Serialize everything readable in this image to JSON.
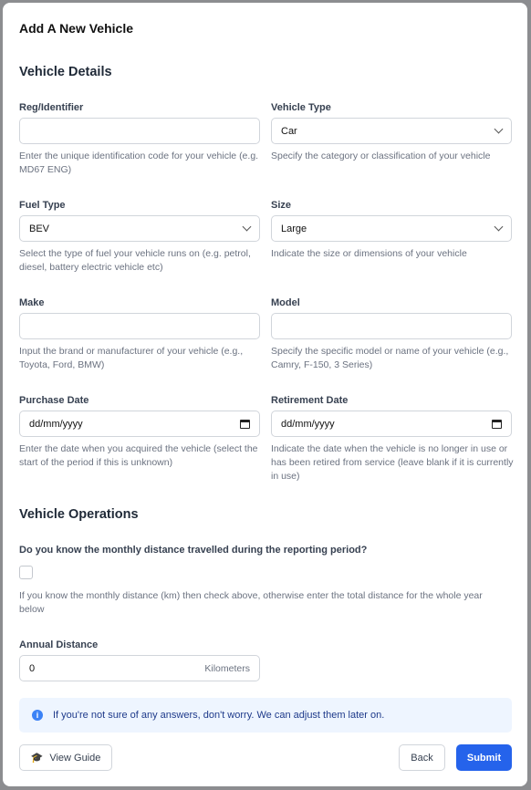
{
  "title": "Add A New Vehicle",
  "details": {
    "heading": "Vehicle Details",
    "fields": [
      {
        "label": "Reg/Identifier",
        "value": "",
        "help": "Enter the unique identification code for your vehicle (e.g. MD67 ENG)"
      },
      {
        "label": "Vehicle Type",
        "value": "Car",
        "help": "Specify the category or classification of your vehicle"
      },
      {
        "label": "Fuel Type",
        "value": "BEV",
        "help": "Select the type of fuel your vehicle runs on (e.g. petrol, diesel, battery electric vehicle etc)"
      },
      {
        "label": "Size",
        "value": "Large",
        "help": "Indicate the size or dimensions of your vehicle"
      },
      {
        "label": "Make",
        "value": "",
        "help": "Input the brand or manufacturer of your vehicle (e.g., Toyota, Ford, BMW)"
      },
      {
        "label": "Model",
        "value": "",
        "help": "Specify the specific model or name of your vehicle (e.g., Camry, F-150, 3 Series)"
      },
      {
        "label": "Purchase Date",
        "value": "dd/mm/yyyy",
        "help": "Enter the date when you acquired the vehicle (select the start of the period if this is unknown)"
      },
      {
        "label": "Retirement Date",
        "value": "dd/mm/yyyy",
        "help": "Indicate the date when the vehicle is no longer in use or has been retired from service (leave blank if it is currently in use)"
      }
    ]
  },
  "operations": {
    "heading": "Vehicle Operations",
    "question": "Do you know the monthly distance travelled during the reporting period?",
    "checked": false,
    "help": "If you know the monthly distance (km) then check above, otherwise enter the total distance for the whole year below",
    "annual_label": "Annual Distance",
    "annual_value": "0",
    "annual_unit": "Kilometers"
  },
  "info": "If you're not sure of any answers, don't worry. We can adjust them later on.",
  "buttons": {
    "guide": "View Guide",
    "back": "Back",
    "submit": "Submit"
  },
  "colors": {
    "primary": "#2563eb",
    "info_bg": "#eef5ff"
  }
}
